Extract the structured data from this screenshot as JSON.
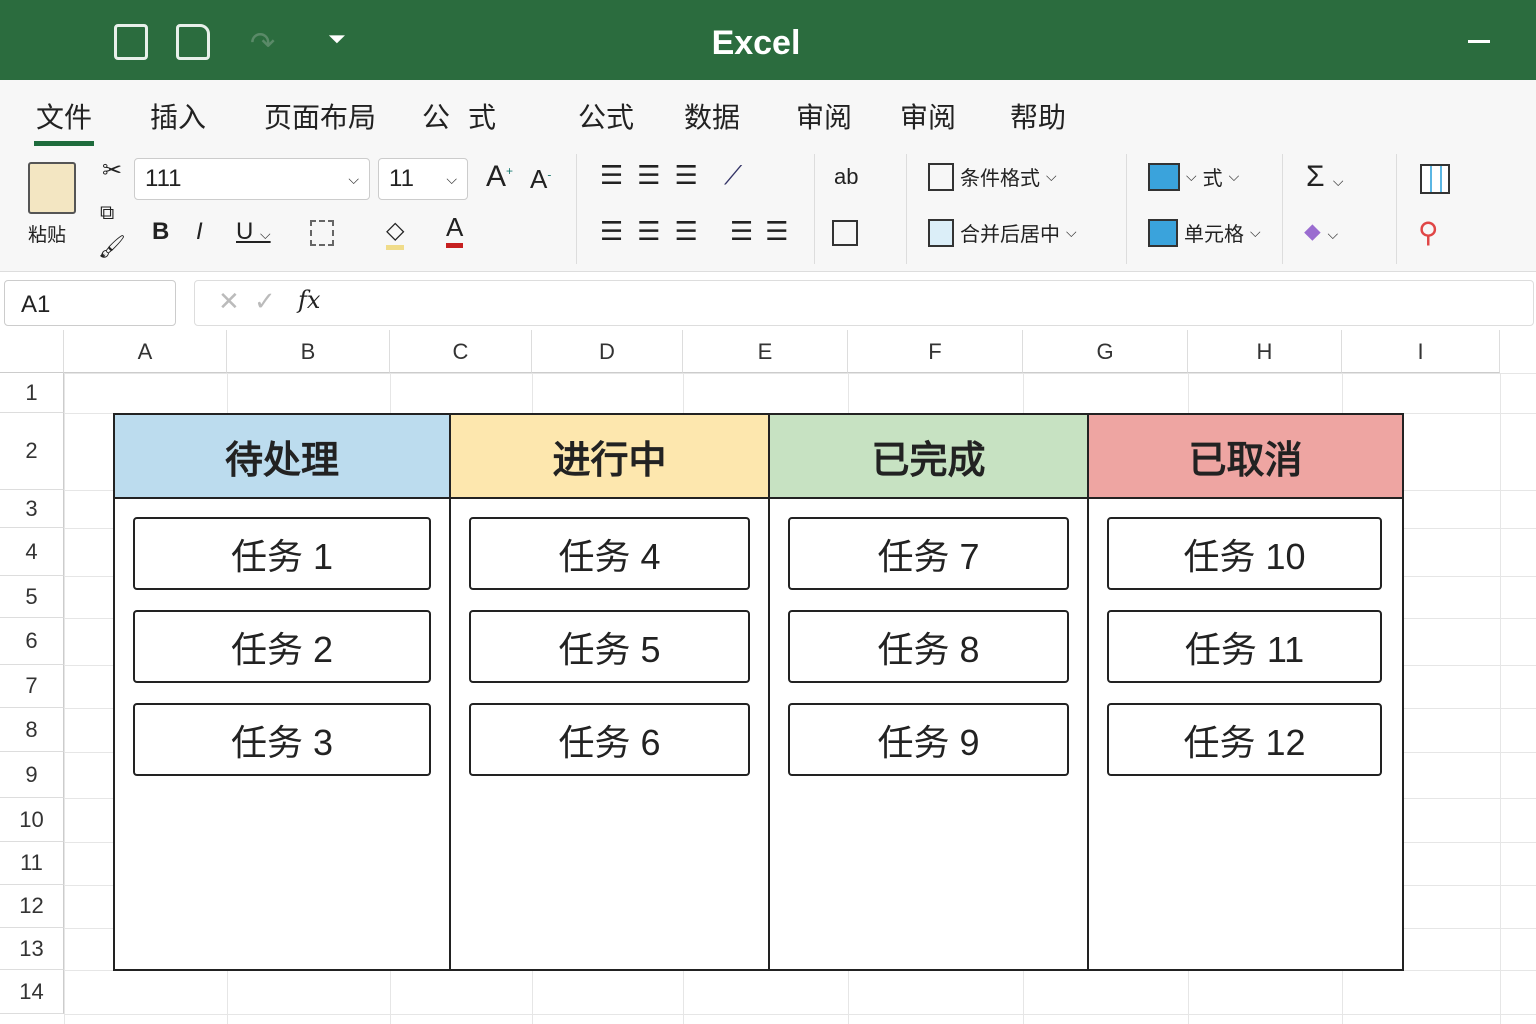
{
  "app": {
    "title": "Excel"
  },
  "tabs": [
    "文件",
    "插入",
    "页面布局",
    "公式",
    "公式",
    "数据",
    "审阅",
    "审阅",
    "帮助"
  ],
  "ribbon": {
    "paste_label": "粘贴",
    "font_name": "111",
    "font_size": "11",
    "conditional_format": "条件格式",
    "merge_center": "合并后居中",
    "format_label": "式",
    "cell_styles": "单元格"
  },
  "formula_bar": {
    "name_box": "A1",
    "fx": "fx",
    "value": ""
  },
  "columns": [
    "A",
    "B",
    "C",
    "D",
    "E",
    "F",
    "G",
    "H",
    "I"
  ],
  "rows": [
    "1",
    "2",
    "3",
    "4",
    "5",
    "6",
    "7",
    "8",
    "9",
    "10",
    "11",
    "12",
    "13",
    "14"
  ],
  "board": {
    "columns": [
      {
        "title": "待处理",
        "color": "#bcdcee",
        "cards": [
          "任务 1",
          "任务 2",
          "任务 3"
        ]
      },
      {
        "title": "进行中",
        "color": "#fde7ae",
        "cards": [
          "任务 4",
          "任务 5",
          "任务 6"
        ]
      },
      {
        "title": "已完成",
        "color": "#c7e2c2",
        "cards": [
          "任务 7",
          "任务 8",
          "任务 9"
        ]
      },
      {
        "title": "已取消",
        "color": "#eea5a2",
        "cards": [
          "任务 10",
          "任务 11",
          "任务 12"
        ]
      }
    ]
  }
}
